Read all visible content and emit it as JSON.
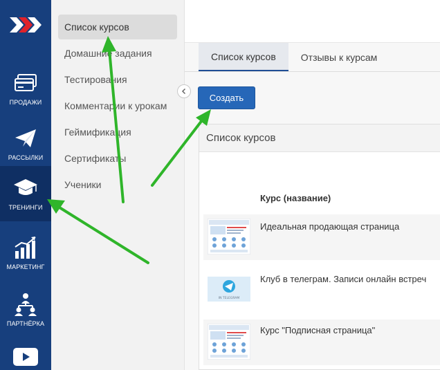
{
  "rail": {
    "items": [
      {
        "label": "ПРОДАЖИ",
        "icon": "credit-card-icon"
      },
      {
        "label": "РАССЫЛКИ",
        "icon": "paper-plane-icon"
      },
      {
        "label": "ТРЕНИНГИ",
        "icon": "graduation-cap-icon"
      },
      {
        "label": "МАРКЕТИНГ",
        "icon": "growth-chart-icon"
      },
      {
        "label": "ПАРТНЁРКА",
        "icon": "partner-network-icon"
      }
    ],
    "active_index": 2,
    "colors": {
      "background": "#173f7d",
      "active": "#0f2f63",
      "logo_red": "#e0232b"
    }
  },
  "submenu": {
    "items": [
      "Список курсов",
      "Домашние задания",
      "Тестирования",
      "Комментарии к урокам",
      "Геймификация",
      "Сертификаты",
      "Ученики"
    ],
    "active_index": 0
  },
  "tabs": [
    "Список курсов",
    "Отзывы к курсам"
  ],
  "active_tab": 0,
  "create_button": "Создать",
  "panel": {
    "title": "Список курсов",
    "column_header": "Курс (название)",
    "courses": [
      {
        "name": "Идеальная продающая страница",
        "thumb": "landing-page-thumbnail"
      },
      {
        "name": "Клуб в телеграм. Записи онлайн встреч",
        "thumb": "telegram-thumbnail",
        "thumb_text": "IN TELEGRAM"
      },
      {
        "name": "Курс \"Подписная страница\"",
        "thumb": "landing-page-thumbnail"
      }
    ]
  },
  "annotation_color": "#2fb52a"
}
